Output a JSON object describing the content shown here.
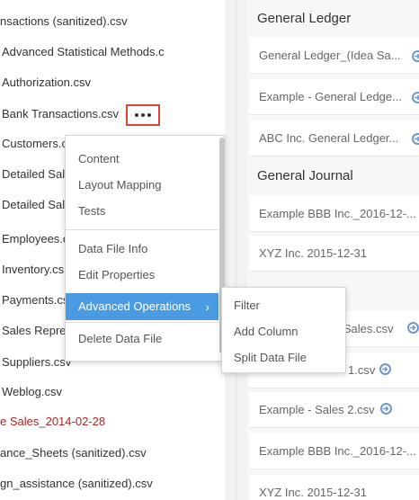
{
  "file_list": [
    "nsactions (sanitized).csv",
    "Advanced Statistical Methods.c",
    "Authorization.csv",
    "Bank Transactions.csv",
    "Customers.c",
    "Detailed Sal",
    "Detailed Sal",
    "Employees.c",
    "Inventory.cs",
    "Payments.cs",
    "Sales Repre",
    "Suppliers.csv",
    "Weblog.csv",
    "e Sales_2014-02-28",
    "ance_Sheets (sanitized).csv",
    "gn_assistance (sanitized).csv"
  ],
  "highlight_color": "#b52323",
  "more_button": {
    "icon": "more-horizontal-icon",
    "outline_color": "#d9453b"
  },
  "context_menu": {
    "items": [
      "Content",
      "Layout Mapping",
      "Tests",
      "Data File Info",
      "Edit Properties",
      "Advanced Operations",
      "Delete Data File"
    ],
    "active_item": "Advanced Operations",
    "active_chevron": "›",
    "active_color": "#4a9be1"
  },
  "submenu": {
    "items": [
      "Filter",
      "Add Column",
      "Split Data File"
    ]
  },
  "right_panel": {
    "sections": [
      {
        "title": "General Ledger",
        "cards": [
          "General Ledger_(Idea Sa...",
          "Example - General Ledge...",
          "ABC Inc. General Ledger..."
        ]
      },
      {
        "title": "General Journal",
        "cards": [
          "Example BBB Inc._2016-12-...",
          "XYZ Inc. 2015-12-31"
        ]
      },
      {
        "title": "",
        "cards": [
          "d Sales.csv",
          "1.csv",
          "Example - Sales 2.csv",
          "Example BBB Inc._2016-12-...",
          "XYZ Inc. 2015-12-31"
        ]
      }
    ]
  }
}
